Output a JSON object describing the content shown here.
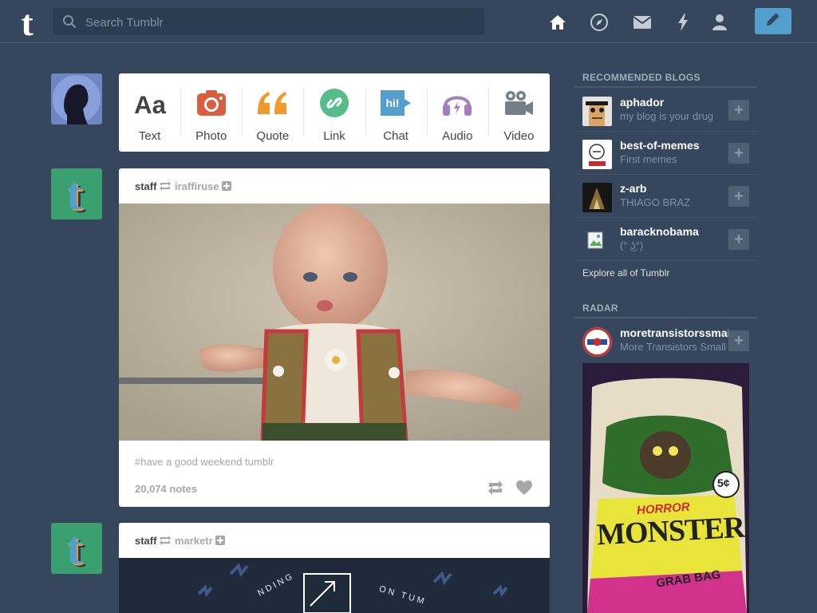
{
  "header": {
    "search_placeholder": "Search Tumblr",
    "nav": [
      "home-icon",
      "explore-icon",
      "inbox-icon",
      "activity-icon",
      "account-icon"
    ],
    "compose_icon": "pencil-icon",
    "colors": {
      "background": "#36465d",
      "compose": "#529ecc"
    }
  },
  "post_types": [
    {
      "label": "Text",
      "icon": "text-icon",
      "color": "#444444"
    },
    {
      "label": "Photo",
      "icon": "camera-icon",
      "color": "#d95e40"
    },
    {
      "label": "Quote",
      "icon": "quote-icon",
      "color": "#f2992e"
    },
    {
      "label": "Link",
      "icon": "link-icon",
      "color": "#56bc8a"
    },
    {
      "label": "Chat",
      "icon": "chat-icon",
      "color": "#529ecc"
    },
    {
      "label": "Audio",
      "icon": "headphones-icon",
      "color": "#a77dc2"
    },
    {
      "label": "Video",
      "icon": "video-camera-icon",
      "color": "#748089"
    }
  ],
  "posts": [
    {
      "blog": "staff",
      "reblogged_from": "iraffiruse",
      "tags": "#have a good weekend tumblr",
      "notes": "20,074 notes"
    },
    {
      "blog": "staff",
      "reblogged_from": "marketr",
      "banner_words": [
        "NDING",
        "ON TUM"
      ]
    }
  ],
  "sidebar": {
    "recommended_title": "RECOMMENDED BLOGS",
    "recommended": [
      {
        "name": "aphador",
        "subtitle": "my blog is your drug"
      },
      {
        "name": "best-of-memes",
        "subtitle": "First memes"
      },
      {
        "name": "z-arb",
        "subtitle": "THIAGO BRAZ"
      },
      {
        "name": "baracknobama",
        "subtitle": "(° ͜ʖ°)"
      }
    ],
    "explore_link": "Explore all of Tumblr",
    "radar_title": "RADAR",
    "radar": {
      "name": "moretransistorssmall",
      "subtitle": "More Transistors Small",
      "image_words": [
        "HORROR",
        "MONSTERS",
        "5¢",
        "GRAB BAG"
      ]
    }
  }
}
